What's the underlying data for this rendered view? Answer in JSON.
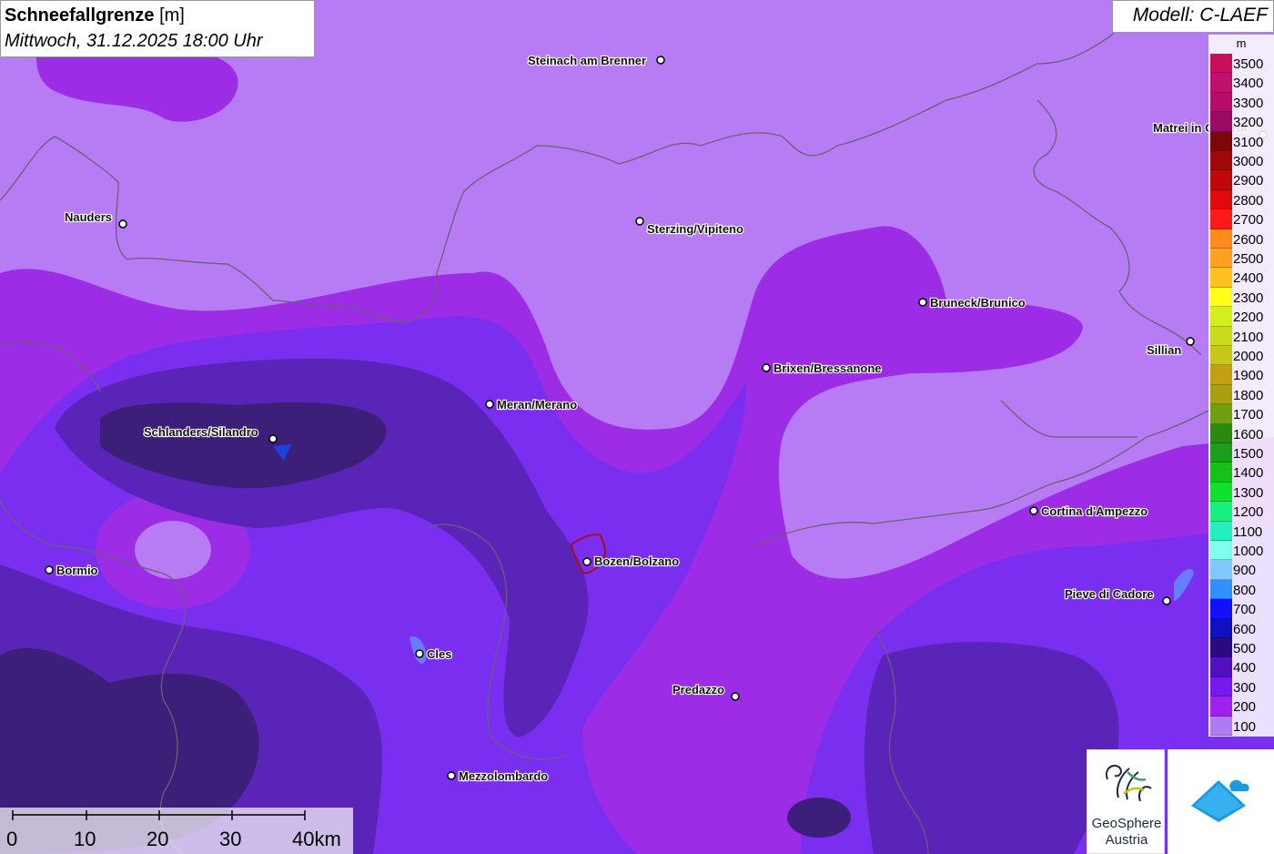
{
  "title": {
    "parameter": "Schneefallgrenze",
    "unit": "[m]",
    "datetime": "Mittwoch, 31.12.2025 18:00 Uhr"
  },
  "model": "Modell: C-LAEF",
  "legend": {
    "unit": "m",
    "entries": [
      {
        "label": "3500",
        "color": "#c8105a"
      },
      {
        "label": "3400",
        "color": "#c10f6c"
      },
      {
        "label": "3300",
        "color": "#b50c6c"
      },
      {
        "label": "3200",
        "color": "#9a0a66"
      },
      {
        "label": "3100",
        "color": "#7a0808"
      },
      {
        "label": "3000",
        "color": "#a00808"
      },
      {
        "label": "2900",
        "color": "#c00808"
      },
      {
        "label": "2800",
        "color": "#e00a0a"
      },
      {
        "label": "2700",
        "color": "#ff1a1a"
      },
      {
        "label": "2600",
        "color": "#ff8c1a"
      },
      {
        "label": "2500",
        "color": "#ffa020"
      },
      {
        "label": "2400",
        "color": "#ffc020"
      },
      {
        "label": "2300",
        "color": "#ffff1a"
      },
      {
        "label": "2200",
        "color": "#d4f01a"
      },
      {
        "label": "2100",
        "color": "#c8dc1a"
      },
      {
        "label": "2000",
        "color": "#c8c81a"
      },
      {
        "label": "1900",
        "color": "#c4a010"
      },
      {
        "label": "1800",
        "color": "#a8a010"
      },
      {
        "label": "1700",
        "color": "#70a010"
      },
      {
        "label": "1600",
        "color": "#2a8a10"
      },
      {
        "label": "1500",
        "color": "#18a018"
      },
      {
        "label": "1400",
        "color": "#18c018"
      },
      {
        "label": "1300",
        "color": "#10e030"
      },
      {
        "label": "1200",
        "color": "#18f080"
      },
      {
        "label": "1100",
        "color": "#20f0c0"
      },
      {
        "label": "1000",
        "color": "#80fff0"
      },
      {
        "label": "900",
        "color": "#80c8ff"
      },
      {
        "label": "800",
        "color": "#3090ff"
      },
      {
        "label": "700",
        "color": "#1010ff"
      },
      {
        "label": "600",
        "color": "#1010c0"
      },
      {
        "label": "500",
        "color": "#2a0a80"
      },
      {
        "label": "400",
        "color": "#5010c0"
      },
      {
        "label": "300",
        "color": "#7818f0"
      },
      {
        "label": "200",
        "color": "#a020f0"
      },
      {
        "label": "100",
        "color": "#b07af0"
      }
    ]
  },
  "cities": [
    {
      "name": "Steinach am Brenner"
    },
    {
      "name": "Matrei in Osttirol"
    },
    {
      "name": "Nauders"
    },
    {
      "name": "Sterzing/Vipiteno"
    },
    {
      "name": "Bruneck/Brunico"
    },
    {
      "name": "Sillian"
    },
    {
      "name": "Brixen/Bressanone"
    },
    {
      "name": "Meran/Merano"
    },
    {
      "name": "Schlanders/Silandro"
    },
    {
      "name": "Cortina d'Ampezzo"
    },
    {
      "name": "Bormio"
    },
    {
      "name": "Bozen/Bolzano"
    },
    {
      "name": "Pieve di Cadore"
    },
    {
      "name": "Cles"
    },
    {
      "name": "Predazzo"
    },
    {
      "name": "Mezzolombardo"
    }
  ],
  "scale": {
    "labels": [
      "0",
      "10",
      "20",
      "30",
      "40km"
    ]
  },
  "logos": {
    "geosphere_line1": "GeoSphere",
    "geosphere_line2": "Austria"
  },
  "colors": {
    "band_100": "#b77cf3",
    "band_200": "#9d2ce6",
    "band_300": "#7a2ef0",
    "band_400": "#5a24b8",
    "band_500": "#3b1f78"
  }
}
